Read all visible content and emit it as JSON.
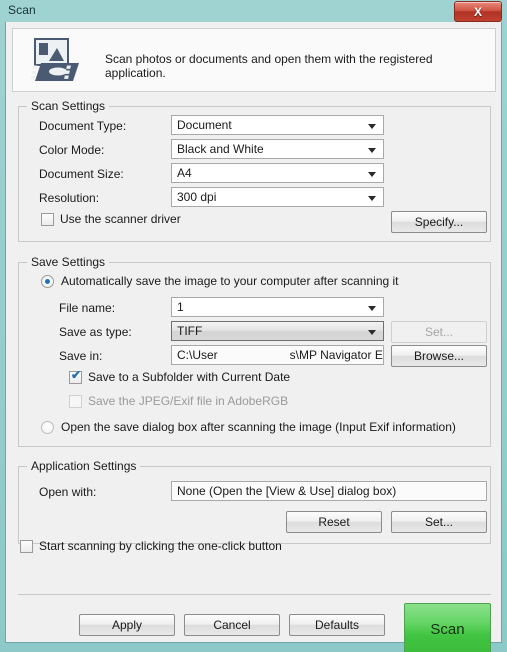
{
  "window": {
    "title": "Scan",
    "close_label": "X",
    "icon": "photo-film-scan-icon"
  },
  "banner": {
    "description": "Scan photos or documents and open them with the registered application."
  },
  "scan_settings": {
    "title": "Scan Settings",
    "document_type": {
      "label": "Document Type:",
      "value": "Document"
    },
    "color_mode": {
      "label": "Color Mode:",
      "value": "Black and White"
    },
    "document_size": {
      "label": "Document Size:",
      "value": "A4"
    },
    "resolution": {
      "label": "Resolution:",
      "value": "300 dpi"
    },
    "use_scanner_driver": {
      "label": "Use the scanner driver",
      "checked": false
    },
    "specify_button": "Specify..."
  },
  "save_settings": {
    "title": "Save Settings",
    "auto_save_radio": {
      "label": "Automatically save the image to your computer after scanning it",
      "selected": true
    },
    "file_name": {
      "label": "File name:",
      "value": "1"
    },
    "save_as_type": {
      "label": "Save as type:",
      "value": "TIFF"
    },
    "set_button": "Set...",
    "save_in": {
      "label": "Save in:",
      "value_prefix": "C:\\User",
      "value_suffix": "s\\MP Navigator E."
    },
    "browse_button": "Browse...",
    "subfolder_checkbox": {
      "label": "Save to a Subfolder with Current Date",
      "checked": true
    },
    "adobergb_checkbox": {
      "label": "Save the JPEG/Exif file in AdobeRGB",
      "checked": false,
      "enabled": false
    },
    "open_dialog_radio": {
      "label": "Open the save dialog box after scanning the image (Input Exif information)",
      "selected": false
    }
  },
  "application_settings": {
    "title": "Application Settings",
    "open_with": {
      "label": "Open with:",
      "value": "None (Open the [View & Use] dialog box)"
    },
    "reset_button": "Reset",
    "set_button": "Set..."
  },
  "footer": {
    "one_click_checkbox": {
      "label": "Start scanning by clicking the one-click button",
      "checked": false
    },
    "apply_button": "Apply",
    "cancel_button": "Cancel",
    "defaults_button": "Defaults",
    "scan_button": "Scan"
  },
  "colors": {
    "titlebar": "#8fcdcd",
    "close_red": "#c0412f",
    "scan_green": "#41c441",
    "accent_blue": "#2272bb"
  }
}
